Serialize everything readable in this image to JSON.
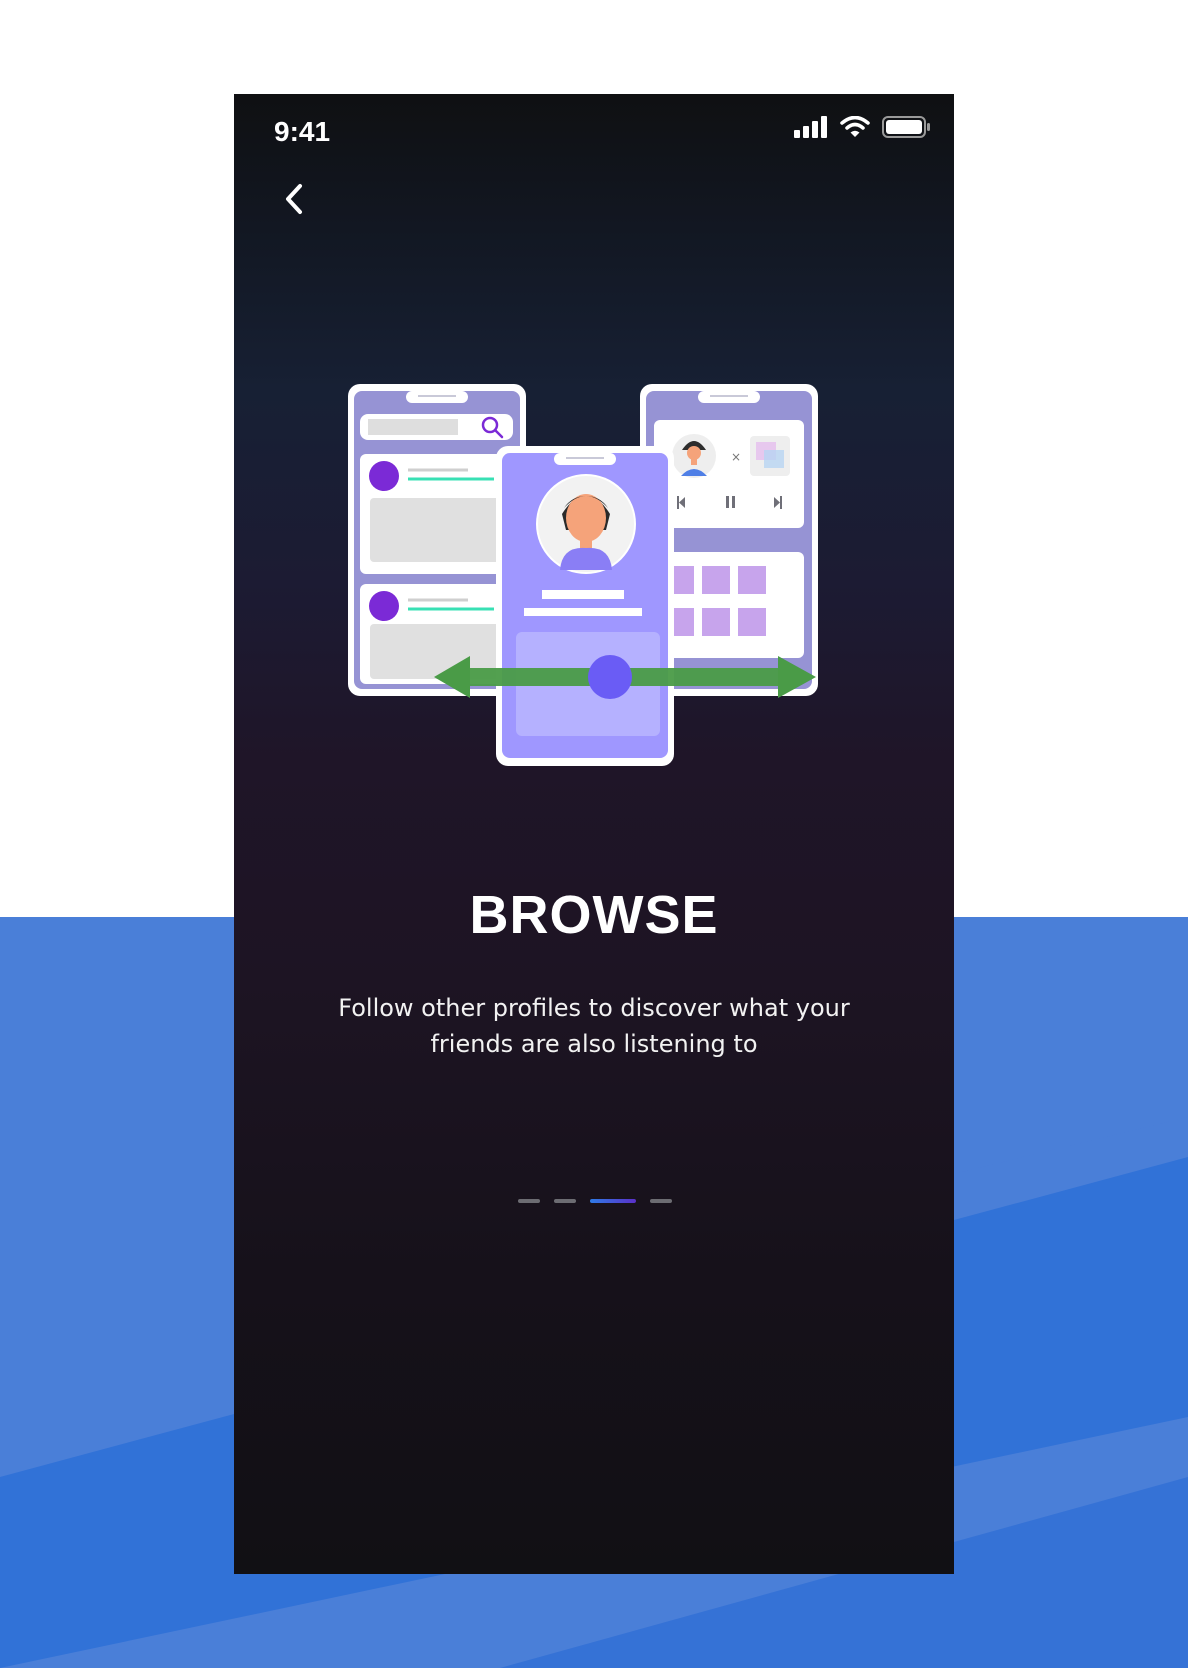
{
  "status_bar": {
    "time": "9:41"
  },
  "icons": {
    "back": "chevron-left-icon",
    "signal": "cellular-signal-icon",
    "wifi": "wifi-icon",
    "battery": "battery-icon"
  },
  "onboarding": {
    "title": "BROWSE",
    "subtitle": "Follow other profiles to discover what your friends are also listening to",
    "page_count": 4,
    "active_page_index": 2
  },
  "colors": {
    "background_blue": "#4a7fd8",
    "accent_purple": "#7b2ad6",
    "arrow_green": "#4a9b47",
    "pager_active": "#2f7be6"
  }
}
